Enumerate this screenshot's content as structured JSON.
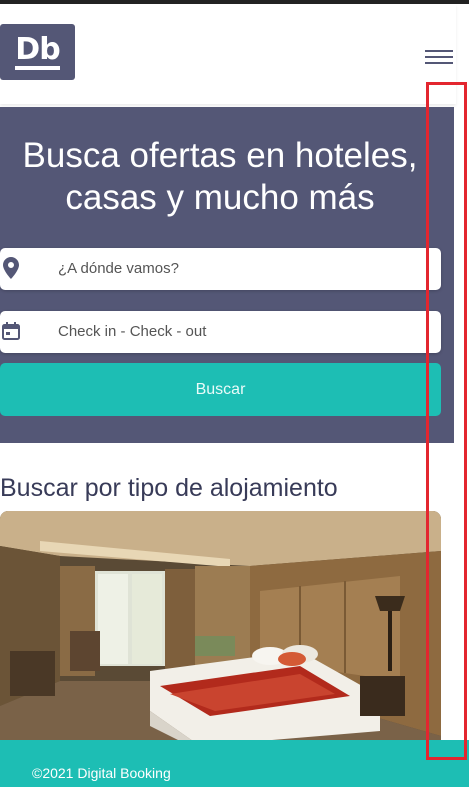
{
  "header": {
    "logo_text": "Db",
    "menu_icon": "hamburger-menu-icon"
  },
  "hero": {
    "title": "Busca ofertas en hoteles, casas y mucho más",
    "destination": {
      "placeholder": "¿A dónde vamos?",
      "icon": "location-pin-icon"
    },
    "dates": {
      "placeholder": "Check in - Check - out",
      "icon": "calendar-icon"
    },
    "search_label": "Buscar"
  },
  "categories": {
    "title": "Buscar por tipo de alojamiento",
    "image": "hotel-bedroom-image"
  },
  "footer": {
    "copyright": "©2021 Digital Booking"
  },
  "colors": {
    "primary": "#545776",
    "accent": "#1dbeb4",
    "heading": "#383b58",
    "highlight": "#e3262f"
  }
}
